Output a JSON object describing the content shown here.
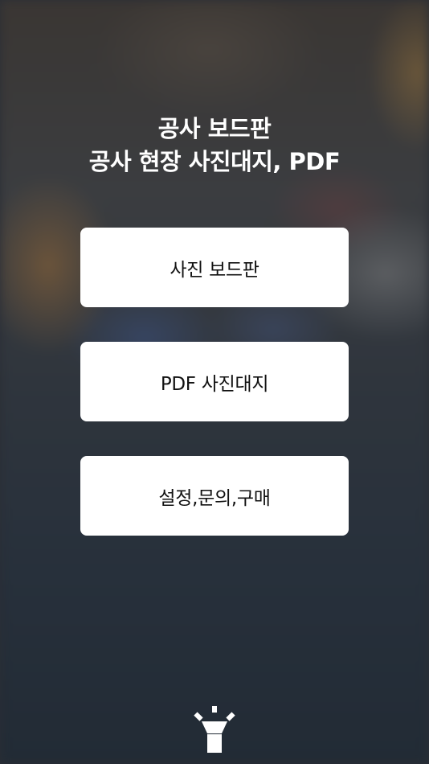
{
  "header": {
    "title_line1": "공사 보드판",
    "title_line2": "공사 현장 사진대지, PDF"
  },
  "menu": {
    "photo_board_label": "사진 보드판",
    "pdf_photo_sheet_label": "PDF 사진대지",
    "settings_label": "설정,문의,구매"
  },
  "footer": {
    "icon": "flashlight-icon"
  },
  "colors": {
    "button_background": "#ffffff",
    "title_text": "#ffffff",
    "button_text": "#111111"
  }
}
